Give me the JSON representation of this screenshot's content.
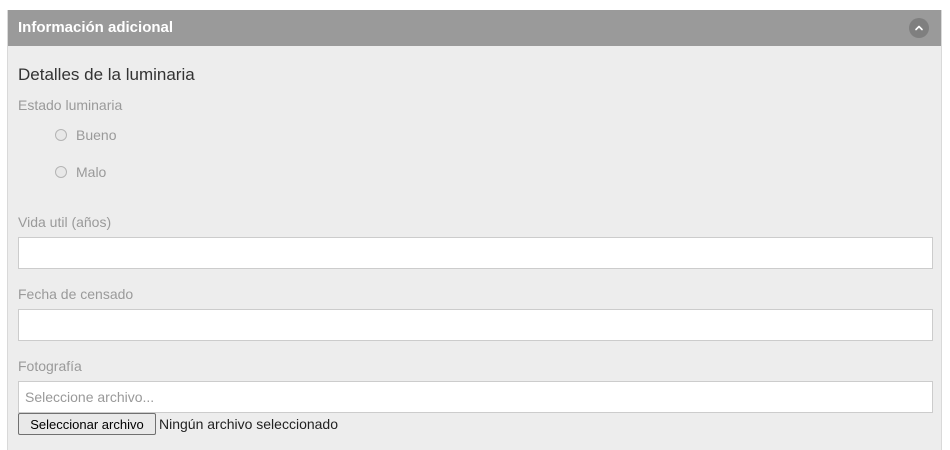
{
  "panel": {
    "title": "Información adicional",
    "collapse_icon": "chevron-up-icon"
  },
  "section": {
    "title": "Detalles de la luminaria"
  },
  "estado": {
    "label": "Estado luminaria",
    "options": [
      {
        "label": "Bueno",
        "selected": false
      },
      {
        "label": "Malo",
        "selected": false
      }
    ]
  },
  "vida_util": {
    "label": "Vida util (años)",
    "value": "",
    "placeholder": ""
  },
  "fecha_censado": {
    "label": "Fecha de censado",
    "value": "",
    "placeholder": ""
  },
  "fotografia": {
    "label": "Fotografía",
    "placeholder": "Seleccione archivo...",
    "button_label": "Seleccionar archivo",
    "status": "Ningún archivo seleccionado"
  }
}
